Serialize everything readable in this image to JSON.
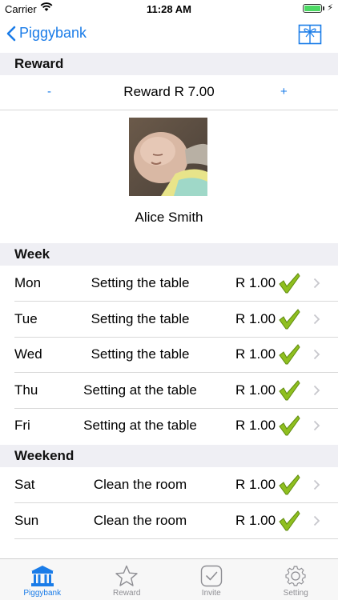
{
  "status_bar": {
    "carrier": "Carrier",
    "time": "11:28 AM"
  },
  "nav": {
    "back_label": "Piggybank",
    "right_icon": "gift-icon"
  },
  "reward_section": {
    "header": "Reward",
    "decrement_label": "-",
    "increment_label": "+",
    "reward_label": "Reward R 7.00"
  },
  "child": {
    "name": "Alice Smith"
  },
  "week": {
    "header": "Week",
    "rows": [
      {
        "day": "Mon",
        "task": "Setting the table",
        "amount": "R 1.00",
        "done": true
      },
      {
        "day": "Tue",
        "task": "Setting the table",
        "amount": "R 1.00",
        "done": true
      },
      {
        "day": "Wed",
        "task": "Setting the table",
        "amount": "R 1.00",
        "done": true
      },
      {
        "day": "Thu",
        "task": "Setting at the table",
        "amount": "R 1.00",
        "done": true
      },
      {
        "day": "Fri",
        "task": "Setting at the table",
        "amount": "R 1.00",
        "done": true
      }
    ]
  },
  "weekend": {
    "header": "Weekend",
    "rows": [
      {
        "day": "Sat",
        "task": "Clean the room",
        "amount": "R 1.00",
        "done": true
      },
      {
        "day": "Sun",
        "task": "Clean the room",
        "amount": "R 1.00",
        "done": true
      }
    ]
  },
  "tabs": [
    {
      "label": "Piggybank",
      "icon": "bank-icon",
      "active": true
    },
    {
      "label": "Reward",
      "icon": "star-icon",
      "active": false
    },
    {
      "label": "Invite",
      "icon": "checkbox-icon",
      "active": false
    },
    {
      "label": "Setting",
      "icon": "gear-icon",
      "active": false
    }
  ],
  "colors": {
    "accent": "#1a7ce8",
    "check": "#8fbf1f",
    "section_bg": "#efeff4",
    "inactive_tab": "#8e8e93"
  }
}
